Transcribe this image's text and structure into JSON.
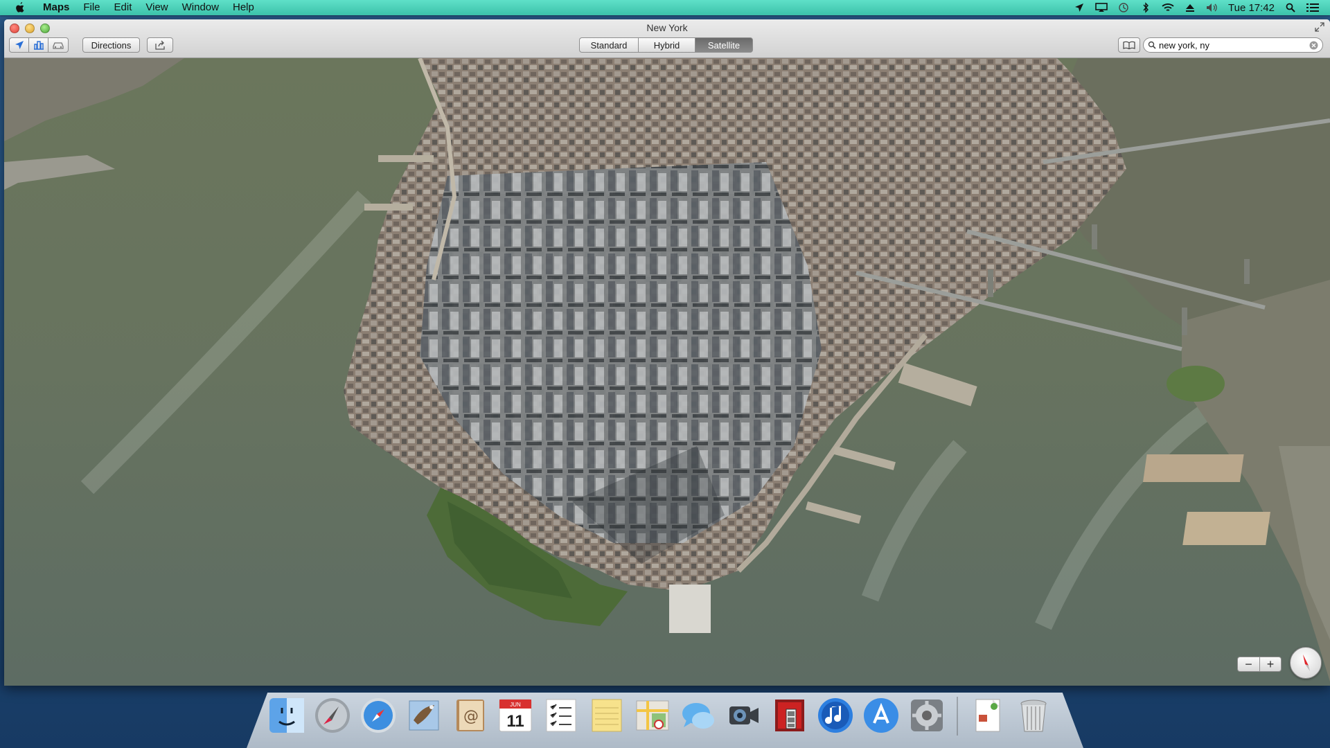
{
  "menubar": {
    "app_name": "Maps",
    "items": [
      "File",
      "Edit",
      "View",
      "Window",
      "Help"
    ],
    "clock": "Tue 17:42",
    "status_icons": [
      "location-icon",
      "airplay-icon",
      "time-machine-icon",
      "bluetooth-icon",
      "wifi-icon",
      "eject-icon",
      "volume-icon",
      "spotlight-icon",
      "notification-center-icon"
    ]
  },
  "window": {
    "title": "New York",
    "toolbar": {
      "directions_label": "Directions",
      "map_modes": [
        "Standard",
        "Hybrid",
        "Satellite"
      ],
      "selected_mode": "Satellite",
      "search_value": "new york, ny"
    },
    "map_controls": {
      "zoom_out": "−",
      "zoom_in": "+"
    }
  },
  "dock": {
    "apps": [
      "Finder",
      "Launchpad",
      "Safari",
      "Mail",
      "Contacts",
      "Calendar",
      "Reminders",
      "Notes",
      "Maps",
      "Messages",
      "FaceTime",
      "Photo Booth",
      "iTunes",
      "App Store",
      "System Preferences"
    ],
    "calendar_day": "11",
    "calendar_month": "JUN",
    "trailing": [
      "Documents",
      "Trash"
    ]
  },
  "colors": {
    "menubar": "#3cc2aa",
    "water": "#66735f",
    "selected_segment": "#6a6a6a"
  }
}
